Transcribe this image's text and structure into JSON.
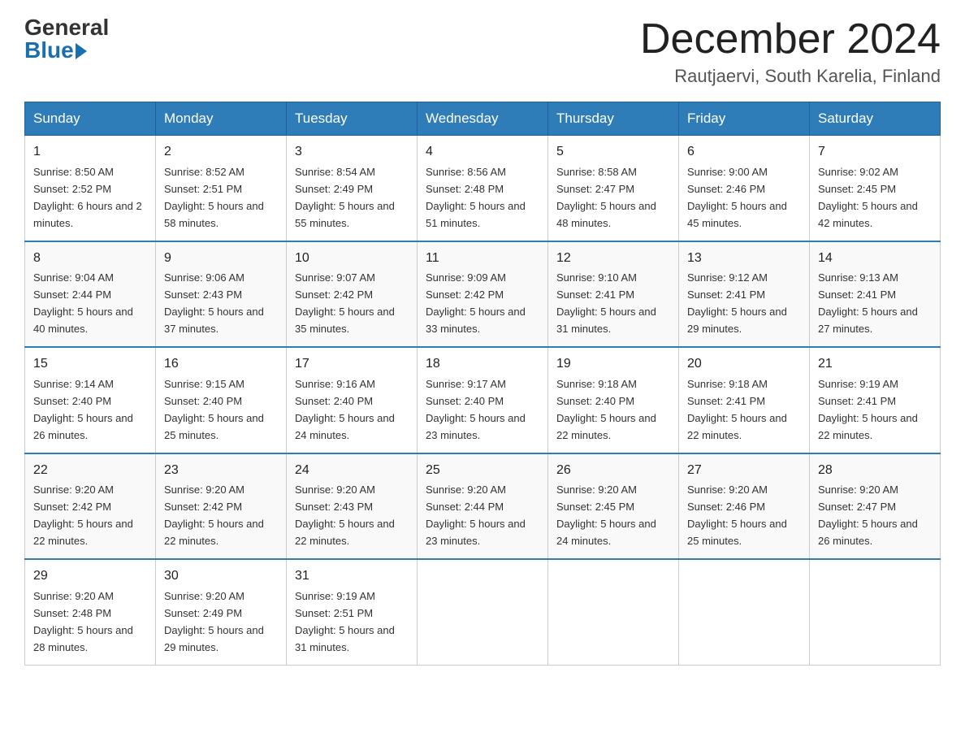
{
  "header": {
    "logo_general": "General",
    "logo_blue": "Blue",
    "month_title": "December 2024",
    "location": "Rautjaervi, South Karelia, Finland"
  },
  "weekdays": [
    "Sunday",
    "Monday",
    "Tuesday",
    "Wednesday",
    "Thursday",
    "Friday",
    "Saturday"
  ],
  "weeks": [
    [
      {
        "day": "1",
        "sunrise": "Sunrise: 8:50 AM",
        "sunset": "Sunset: 2:52 PM",
        "daylight": "Daylight: 6 hours and 2 minutes."
      },
      {
        "day": "2",
        "sunrise": "Sunrise: 8:52 AM",
        "sunset": "Sunset: 2:51 PM",
        "daylight": "Daylight: 5 hours and 58 minutes."
      },
      {
        "day": "3",
        "sunrise": "Sunrise: 8:54 AM",
        "sunset": "Sunset: 2:49 PM",
        "daylight": "Daylight: 5 hours and 55 minutes."
      },
      {
        "day": "4",
        "sunrise": "Sunrise: 8:56 AM",
        "sunset": "Sunset: 2:48 PM",
        "daylight": "Daylight: 5 hours and 51 minutes."
      },
      {
        "day": "5",
        "sunrise": "Sunrise: 8:58 AM",
        "sunset": "Sunset: 2:47 PM",
        "daylight": "Daylight: 5 hours and 48 minutes."
      },
      {
        "day": "6",
        "sunrise": "Sunrise: 9:00 AM",
        "sunset": "Sunset: 2:46 PM",
        "daylight": "Daylight: 5 hours and 45 minutes."
      },
      {
        "day": "7",
        "sunrise": "Sunrise: 9:02 AM",
        "sunset": "Sunset: 2:45 PM",
        "daylight": "Daylight: 5 hours and 42 minutes."
      }
    ],
    [
      {
        "day": "8",
        "sunrise": "Sunrise: 9:04 AM",
        "sunset": "Sunset: 2:44 PM",
        "daylight": "Daylight: 5 hours and 40 minutes."
      },
      {
        "day": "9",
        "sunrise": "Sunrise: 9:06 AM",
        "sunset": "Sunset: 2:43 PM",
        "daylight": "Daylight: 5 hours and 37 minutes."
      },
      {
        "day": "10",
        "sunrise": "Sunrise: 9:07 AM",
        "sunset": "Sunset: 2:42 PM",
        "daylight": "Daylight: 5 hours and 35 minutes."
      },
      {
        "day": "11",
        "sunrise": "Sunrise: 9:09 AM",
        "sunset": "Sunset: 2:42 PM",
        "daylight": "Daylight: 5 hours and 33 minutes."
      },
      {
        "day": "12",
        "sunrise": "Sunrise: 9:10 AM",
        "sunset": "Sunset: 2:41 PM",
        "daylight": "Daylight: 5 hours and 31 minutes."
      },
      {
        "day": "13",
        "sunrise": "Sunrise: 9:12 AM",
        "sunset": "Sunset: 2:41 PM",
        "daylight": "Daylight: 5 hours and 29 minutes."
      },
      {
        "day": "14",
        "sunrise": "Sunrise: 9:13 AM",
        "sunset": "Sunset: 2:41 PM",
        "daylight": "Daylight: 5 hours and 27 minutes."
      }
    ],
    [
      {
        "day": "15",
        "sunrise": "Sunrise: 9:14 AM",
        "sunset": "Sunset: 2:40 PM",
        "daylight": "Daylight: 5 hours and 26 minutes."
      },
      {
        "day": "16",
        "sunrise": "Sunrise: 9:15 AM",
        "sunset": "Sunset: 2:40 PM",
        "daylight": "Daylight: 5 hours and 25 minutes."
      },
      {
        "day": "17",
        "sunrise": "Sunrise: 9:16 AM",
        "sunset": "Sunset: 2:40 PM",
        "daylight": "Daylight: 5 hours and 24 minutes."
      },
      {
        "day": "18",
        "sunrise": "Sunrise: 9:17 AM",
        "sunset": "Sunset: 2:40 PM",
        "daylight": "Daylight: 5 hours and 23 minutes."
      },
      {
        "day": "19",
        "sunrise": "Sunrise: 9:18 AM",
        "sunset": "Sunset: 2:40 PM",
        "daylight": "Daylight: 5 hours and 22 minutes."
      },
      {
        "day": "20",
        "sunrise": "Sunrise: 9:18 AM",
        "sunset": "Sunset: 2:41 PM",
        "daylight": "Daylight: 5 hours and 22 minutes."
      },
      {
        "day": "21",
        "sunrise": "Sunrise: 9:19 AM",
        "sunset": "Sunset: 2:41 PM",
        "daylight": "Daylight: 5 hours and 22 minutes."
      }
    ],
    [
      {
        "day": "22",
        "sunrise": "Sunrise: 9:20 AM",
        "sunset": "Sunset: 2:42 PM",
        "daylight": "Daylight: 5 hours and 22 minutes."
      },
      {
        "day": "23",
        "sunrise": "Sunrise: 9:20 AM",
        "sunset": "Sunset: 2:42 PM",
        "daylight": "Daylight: 5 hours and 22 minutes."
      },
      {
        "day": "24",
        "sunrise": "Sunrise: 9:20 AM",
        "sunset": "Sunset: 2:43 PM",
        "daylight": "Daylight: 5 hours and 22 minutes."
      },
      {
        "day": "25",
        "sunrise": "Sunrise: 9:20 AM",
        "sunset": "Sunset: 2:44 PM",
        "daylight": "Daylight: 5 hours and 23 minutes."
      },
      {
        "day": "26",
        "sunrise": "Sunrise: 9:20 AM",
        "sunset": "Sunset: 2:45 PM",
        "daylight": "Daylight: 5 hours and 24 minutes."
      },
      {
        "day": "27",
        "sunrise": "Sunrise: 9:20 AM",
        "sunset": "Sunset: 2:46 PM",
        "daylight": "Daylight: 5 hours and 25 minutes."
      },
      {
        "day": "28",
        "sunrise": "Sunrise: 9:20 AM",
        "sunset": "Sunset: 2:47 PM",
        "daylight": "Daylight: 5 hours and 26 minutes."
      }
    ],
    [
      {
        "day": "29",
        "sunrise": "Sunrise: 9:20 AM",
        "sunset": "Sunset: 2:48 PM",
        "daylight": "Daylight: 5 hours and 28 minutes."
      },
      {
        "day": "30",
        "sunrise": "Sunrise: 9:20 AM",
        "sunset": "Sunset: 2:49 PM",
        "daylight": "Daylight: 5 hours and 29 minutes."
      },
      {
        "day": "31",
        "sunrise": "Sunrise: 9:19 AM",
        "sunset": "Sunset: 2:51 PM",
        "daylight": "Daylight: 5 hours and 31 minutes."
      },
      null,
      null,
      null,
      null
    ]
  ]
}
